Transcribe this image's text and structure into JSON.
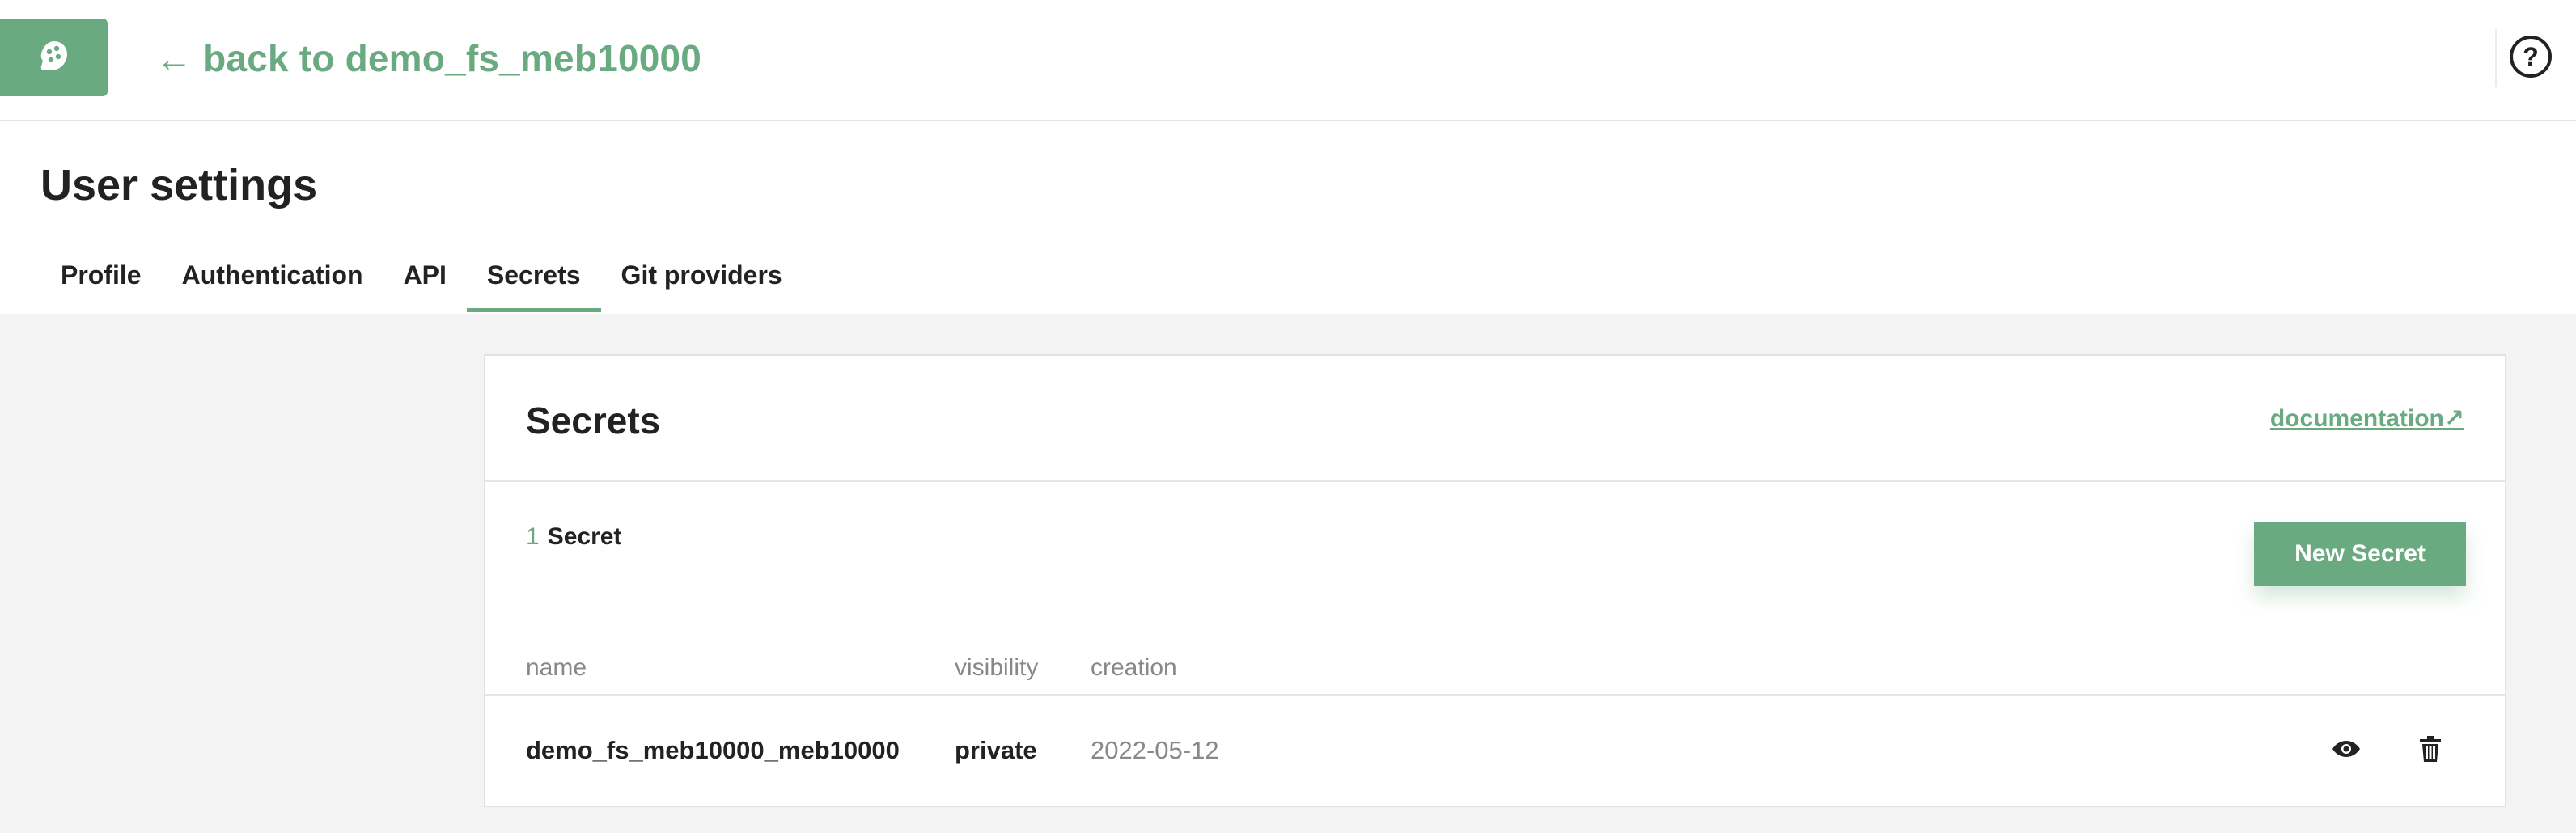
{
  "topbar": {
    "logo_icon": "hop-logo-icon",
    "back_label": "← back to demo_fs_meb10000",
    "help_label": "?",
    "help_icon": "help-circle-icon",
    "accent_color": "#6aaa81"
  },
  "settings": {
    "title": "User settings",
    "tabs": [
      {
        "label": "Profile",
        "active": false
      },
      {
        "label": "Authentication",
        "active": false
      },
      {
        "label": "API",
        "active": false
      },
      {
        "label": "Secrets",
        "active": true
      },
      {
        "label": "Git providers",
        "active": false
      }
    ]
  },
  "secrets_card": {
    "title": "Secrets",
    "doc_link_label": "documentation↗",
    "count": "1",
    "count_label": "Secret",
    "new_button_label": "New Secret",
    "columns": {
      "name": "name",
      "visibility": "visibility",
      "creation": "creation"
    },
    "rows": [
      {
        "name": "demo_fs_meb10000_meb10000",
        "visibility": "private",
        "creation": "2022-05-12",
        "actions": [
          "eye-icon",
          "trash-icon"
        ]
      }
    ]
  }
}
